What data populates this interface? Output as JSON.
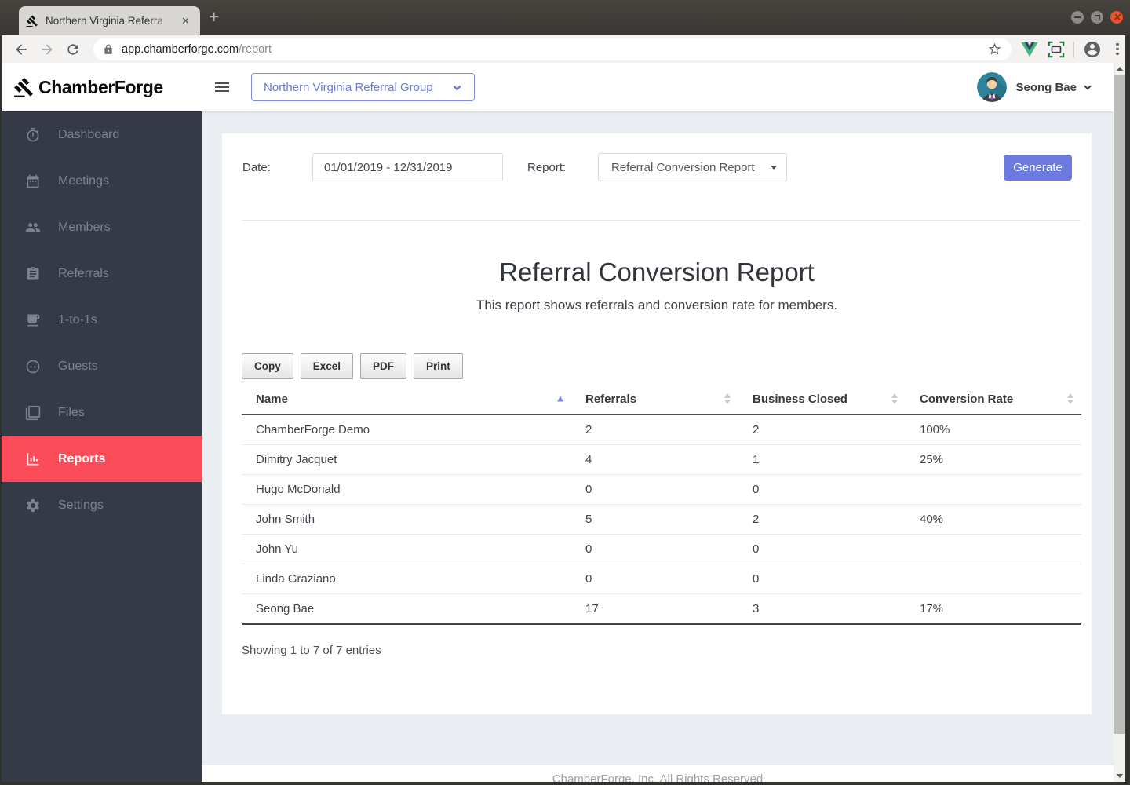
{
  "browser": {
    "tab_title": "Northern Virginia Referra",
    "url_host": "app.chamberforge.com",
    "url_path": "/report"
  },
  "brand": {
    "name": "ChamberForge"
  },
  "topbar": {
    "group_selector": "Northern Virginia Referral Group",
    "user_name": "Seong Bae"
  },
  "sidebar": {
    "items": [
      {
        "label": "Dashboard",
        "icon": "timer-icon",
        "active": false
      },
      {
        "label": "Meetings",
        "icon": "calendar-icon",
        "active": false
      },
      {
        "label": "Members",
        "icon": "people-icon",
        "active": false
      },
      {
        "label": "Referrals",
        "icon": "clipboard-icon",
        "active": false
      },
      {
        "label": "1-to-1s",
        "icon": "coffee-icon",
        "active": false
      },
      {
        "label": "Guests",
        "icon": "face-icon",
        "active": false
      },
      {
        "label": "Files",
        "icon": "files-icon",
        "active": false
      },
      {
        "label": "Reports",
        "icon": "bar-chart-icon",
        "active": true
      },
      {
        "label": "Settings",
        "icon": "gear-icon",
        "active": false
      }
    ]
  },
  "filters": {
    "date_label": "Date:",
    "date_value": "01/01/2019 - 12/31/2019",
    "report_label": "Report:",
    "report_value": "Referral Conversion Report",
    "generate_label": "Generate"
  },
  "report": {
    "title": "Referral Conversion Report",
    "subtitle": "This report shows referrals and conversion rate for members.",
    "export_buttons": {
      "copy": "Copy",
      "excel": "Excel",
      "pdf": "PDF",
      "print": "Print"
    },
    "table": {
      "columns": {
        "name": "Name",
        "referrals": "Referrals",
        "business_closed": "Business Closed",
        "conversion_rate": "Conversion Rate"
      },
      "rows": [
        {
          "name": "ChamberForge Demo",
          "referrals": "2",
          "business_closed": "2",
          "conversion_rate": "100%"
        },
        {
          "name": "Dimitry Jacquet",
          "referrals": "4",
          "business_closed": "1",
          "conversion_rate": "25%"
        },
        {
          "name": "Hugo McDonald",
          "referrals": "0",
          "business_closed": "0",
          "conversion_rate": ""
        },
        {
          "name": "John Smith",
          "referrals": "5",
          "business_closed": "2",
          "conversion_rate": "40%"
        },
        {
          "name": "John Yu",
          "referrals": "0",
          "business_closed": "0",
          "conversion_rate": ""
        },
        {
          "name": "Linda Graziano",
          "referrals": "0",
          "business_closed": "0",
          "conversion_rate": ""
        },
        {
          "name": "Seong Bae",
          "referrals": "17",
          "business_closed": "3",
          "conversion_rate": "17%"
        }
      ]
    },
    "status": "Showing 1 to 7 of 7 entries"
  },
  "page_footer": "ChamberForge, Inc. All Rights Reserved",
  "colors": {
    "sidebar_bg": "#343a46",
    "active_red": "#fc4b59",
    "accent_indigo": "#6c7ae0",
    "link_purple": "#6b79d8",
    "page_bg": "#eaedf2",
    "ubuntu_close": "#e8542c"
  }
}
